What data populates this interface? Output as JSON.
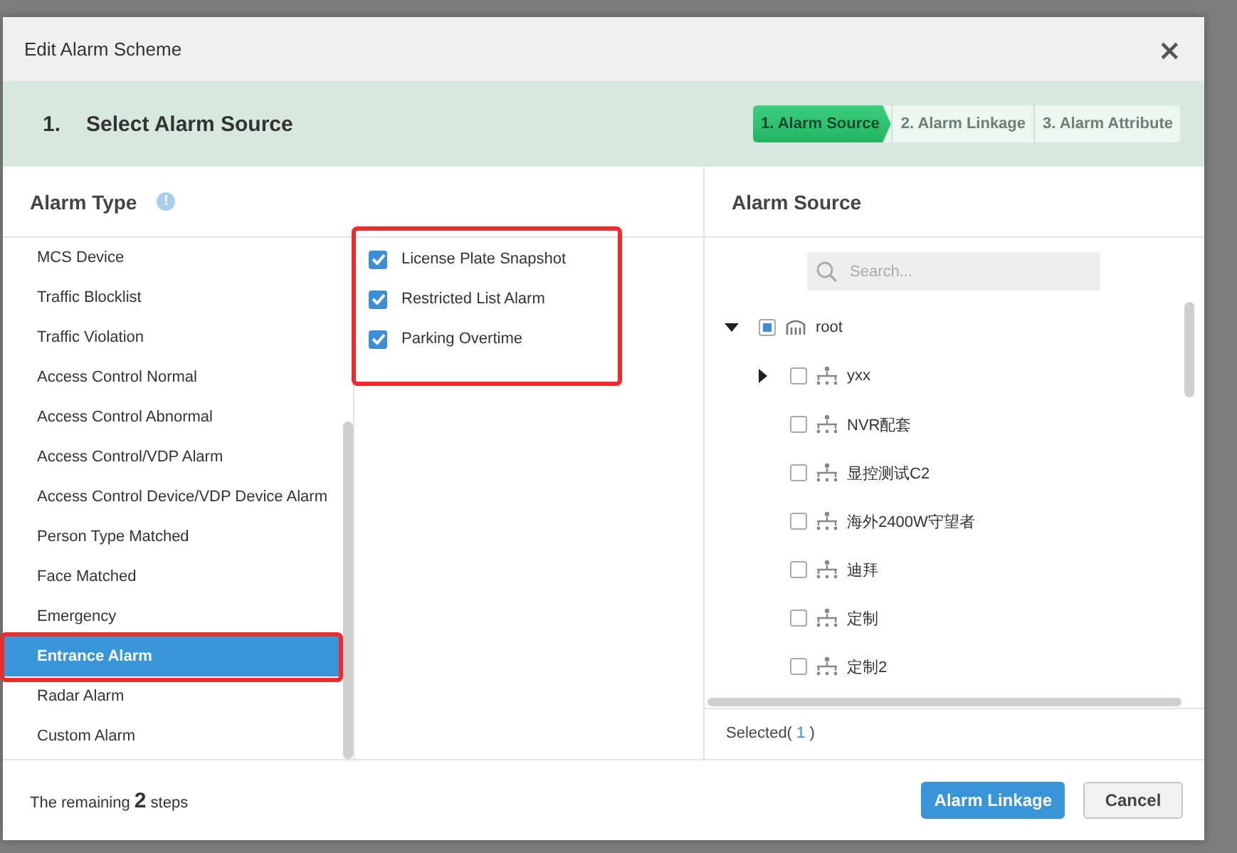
{
  "dialog": {
    "title": "Edit Alarm Scheme",
    "close": "×"
  },
  "step_band": {
    "number": "1.",
    "title": "Select Alarm Source",
    "steps": [
      {
        "label": "1. Alarm Source",
        "selected": true
      },
      {
        "label": "2. Alarm Linkage",
        "selected": false
      },
      {
        "label": "3. Alarm Attribute",
        "selected": false
      }
    ]
  },
  "alarm_type": {
    "title": "Alarm Type",
    "info": "!",
    "items": [
      {
        "label": "MCS Device",
        "selected": false,
        "highlighted": false
      },
      {
        "label": "Traffic Blocklist",
        "selected": false,
        "highlighted": false
      },
      {
        "label": "Traffic Violation",
        "selected": false,
        "highlighted": false
      },
      {
        "label": "Access Control Normal",
        "selected": false,
        "highlighted": false
      },
      {
        "label": "Access Control Abnormal",
        "selected": false,
        "highlighted": false
      },
      {
        "label": "Access Control/VDP Alarm",
        "selected": false,
        "highlighted": false
      },
      {
        "label": "Access Control Device/VDP Device Alarm",
        "selected": false,
        "highlighted": false
      },
      {
        "label": "Person Type Matched",
        "selected": false,
        "highlighted": false
      },
      {
        "label": "Face Matched",
        "selected": false,
        "highlighted": false
      },
      {
        "label": "Emergency",
        "selected": false,
        "highlighted": false
      },
      {
        "label": "Entrance Alarm",
        "selected": true,
        "highlighted": true
      },
      {
        "label": "Radar Alarm",
        "selected": false,
        "highlighted": false
      },
      {
        "label": "Custom Alarm",
        "selected": false,
        "highlighted": false
      }
    ],
    "subtypes_highlighted": true,
    "subtypes": [
      {
        "label": "License Plate Snapshot",
        "checked": true
      },
      {
        "label": "Restricted List Alarm",
        "checked": true
      },
      {
        "label": "Parking Overtime",
        "checked": true
      }
    ]
  },
  "alarm_source": {
    "title": "Alarm Source",
    "search": {
      "placeholder": "Search..."
    },
    "tree": [
      {
        "label": "root",
        "kind": "root",
        "checked": false,
        "partial": true,
        "expanded": true,
        "children": [
          {
            "label": "yxx",
            "kind": "node",
            "checked": false,
            "partial": false,
            "expanded": false
          },
          {
            "label": "NVR配套",
            "kind": "node",
            "checked": false,
            "partial": false
          },
          {
            "label": "显控测试C2",
            "kind": "node",
            "checked": false,
            "partial": false
          },
          {
            "label": "海外2400W守望者",
            "kind": "node",
            "checked": false,
            "partial": false
          },
          {
            "label": "迪拜",
            "kind": "node",
            "checked": false,
            "partial": false
          },
          {
            "label": "定制",
            "kind": "node",
            "checked": false,
            "partial": false
          },
          {
            "label": "定制2",
            "kind": "node",
            "checked": false,
            "partial": false
          }
        ]
      }
    ],
    "selected": {
      "label": "Selected(",
      "count": "1",
      "suffix": ")"
    }
  },
  "footer": {
    "remaining": "The remaining **2** steps",
    "buttons": [
      {
        "label": "Alarm Linkage",
        "kind": "primary"
      },
      {
        "label": "Cancel",
        "kind": "secondary"
      }
    ]
  }
}
